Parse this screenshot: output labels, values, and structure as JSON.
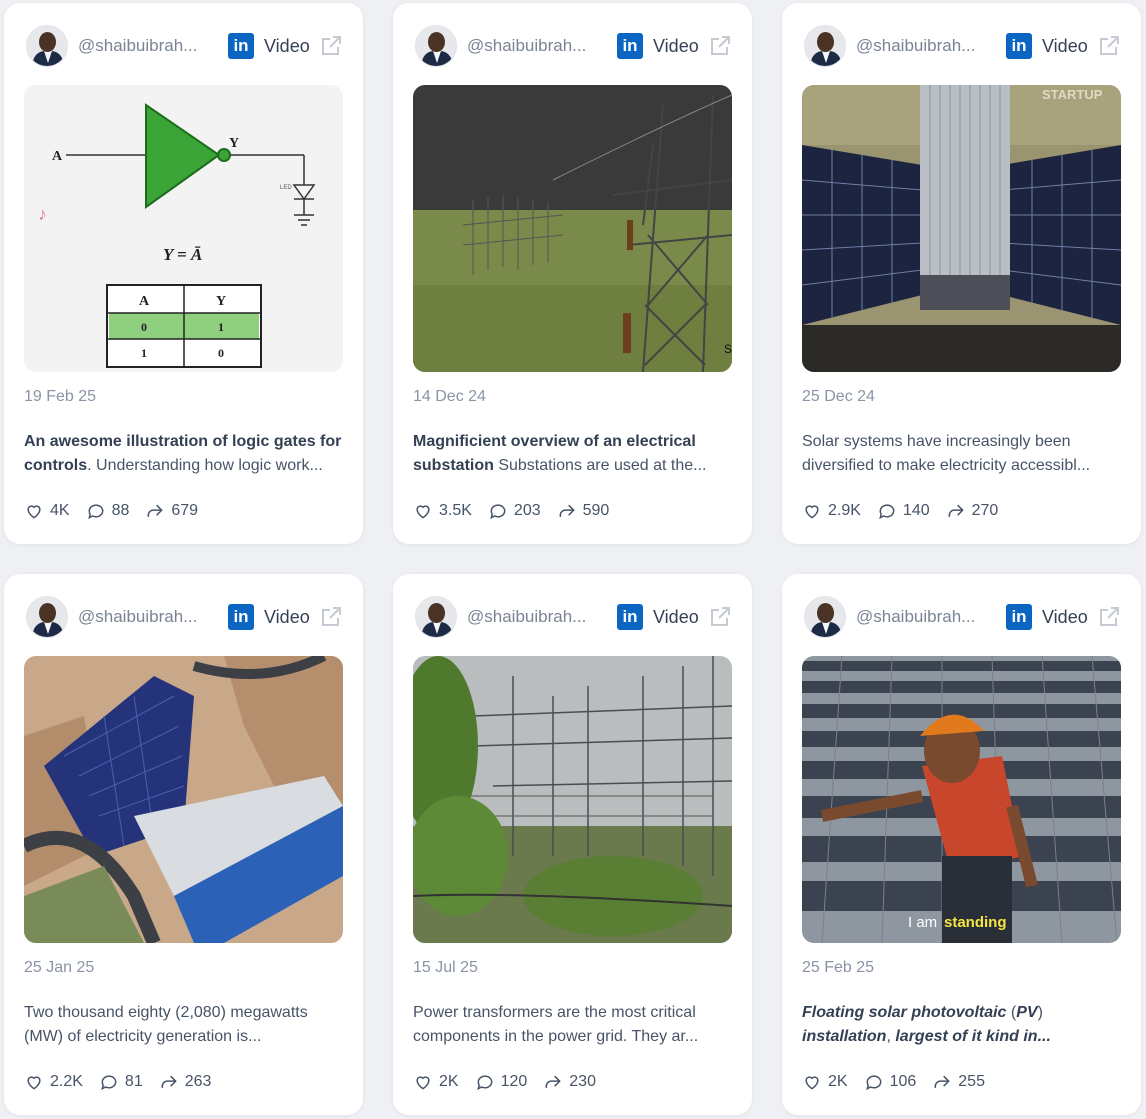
{
  "cards": [
    {
      "handle": "@shaibuibrah...",
      "network_badge": "in",
      "type": "Video",
      "date": "19 Feb 25",
      "bold": "An awesome illustration of logic gates for",
      "line2_bold": "controls",
      "line2_rest": ". Understanding how logic work...",
      "likes": "4K",
      "comments": "88",
      "shares": "679",
      "media": {
        "input_label": "A",
        "output_label": "Y",
        "formula": "Y = Ā",
        "led_label": "LED",
        "table_headers": [
          "A",
          "Y"
        ],
        "table_rows": [
          [
            "0",
            "1"
          ],
          [
            "1",
            "0"
          ]
        ]
      }
    },
    {
      "handle": "@shaibuibrah...",
      "network_badge": "in",
      "type": "Video",
      "date": "14 Dec 24",
      "bold": "Magnificient overview of an electrical",
      "line2_bold": "substation",
      "line2_rest": " Substations are used at the...",
      "likes": "3.5K",
      "comments": "203",
      "shares": "590",
      "media": {
        "corner": "S"
      }
    },
    {
      "handle": "@shaibuibrah...",
      "network_badge": "in",
      "type": "Video",
      "date": "25 Dec 24",
      "line1": "Solar systems have increasingly been",
      "line2": "diversified to make electricity accessibl...",
      "likes": "2.9K",
      "comments": "140",
      "shares": "270",
      "media": {
        "watermark": "STARTUP"
      }
    },
    {
      "handle": "@shaibuibrah...",
      "network_badge": "in",
      "type": "Video",
      "date": "25 Jan 25",
      "line1": "Two thousand eighty (2,080) megawatts",
      "line2": "(MW) of electricity generation is...",
      "likes": "2.2K",
      "comments": "81",
      "shares": "263"
    },
    {
      "handle": "@shaibuibrah...",
      "network_badge": "in",
      "type": "Video",
      "date": "15 Jul 25",
      "line1": "Power transformers are the most critical",
      "line2": "components in the power grid. They ar...",
      "likes": "2K",
      "comments": "120",
      "shares": "230"
    },
    {
      "handle": "@shaibuibrah...",
      "network_badge": "in",
      "type": "Video",
      "date": "25 Feb 25",
      "italic1": "Floating solar photovoltaic",
      "plain1": " (",
      "italic1b": "PV",
      "plain1b": ")",
      "italic2": "installation",
      "plain2": ", ",
      "italic2b": "largest of it kind in...",
      "likes": "2K",
      "comments": "106",
      "shares": "255",
      "media": {
        "caption_plain": "I am ",
        "caption_highlight": "standing"
      }
    }
  ],
  "colors": {
    "linkedin": "#0a66c2",
    "page_bg": "#eef0f4",
    "caption_highlight": "#f5e642"
  },
  "icons": [
    "linkedin-icon",
    "external-link-icon",
    "heart-icon",
    "comment-icon",
    "share-icon"
  ]
}
